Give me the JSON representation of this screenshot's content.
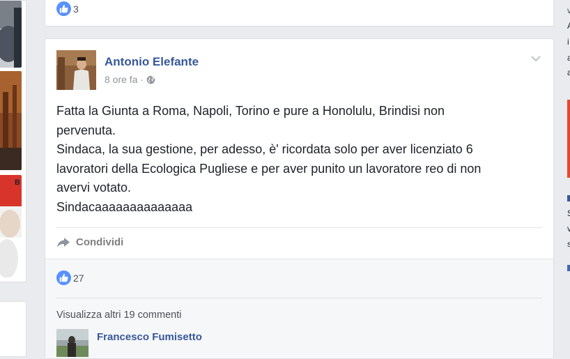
{
  "prev_post": {
    "like_count": "3"
  },
  "post": {
    "author": "Antonio Elefante",
    "time": "8 ore fa",
    "meta_sep": "·",
    "text_lines": [
      "Fatta la Giunta a Roma, Napoli, Torino e pure a Honolulu, Brindisi non",
      "pervenuta.",
      "Sindaca, la sua gestione, per adesso, è' ricordata solo per aver licenziato 6",
      "lavoratori della Ecologica Pugliese e per aver punito un lavoratore reo di non",
      "avervi votato.",
      "Sindacaaaaaaaaaaaaaa"
    ],
    "share_label": "Condividi",
    "like_count": "27",
    "more_comments": "Visualizza altri 19 commenti",
    "commenter": "Francesco Fumisetto"
  },
  "left_column": {
    "fragment": "B"
  },
  "right_column": {
    "fragments": [
      "v",
      "A",
      "i",
      "a",
      "a",
      "S",
      "v",
      "s"
    ]
  },
  "colors": {
    "page_bg": "#e9ebee",
    "link_blue": "#365899",
    "like_blue": "#5890ff",
    "meta_gray": "#90949c",
    "accent_red": "#e9472b"
  },
  "icons": [
    "like-icon",
    "globe-icon",
    "chevron-down-icon",
    "share-arrow-icon"
  ]
}
